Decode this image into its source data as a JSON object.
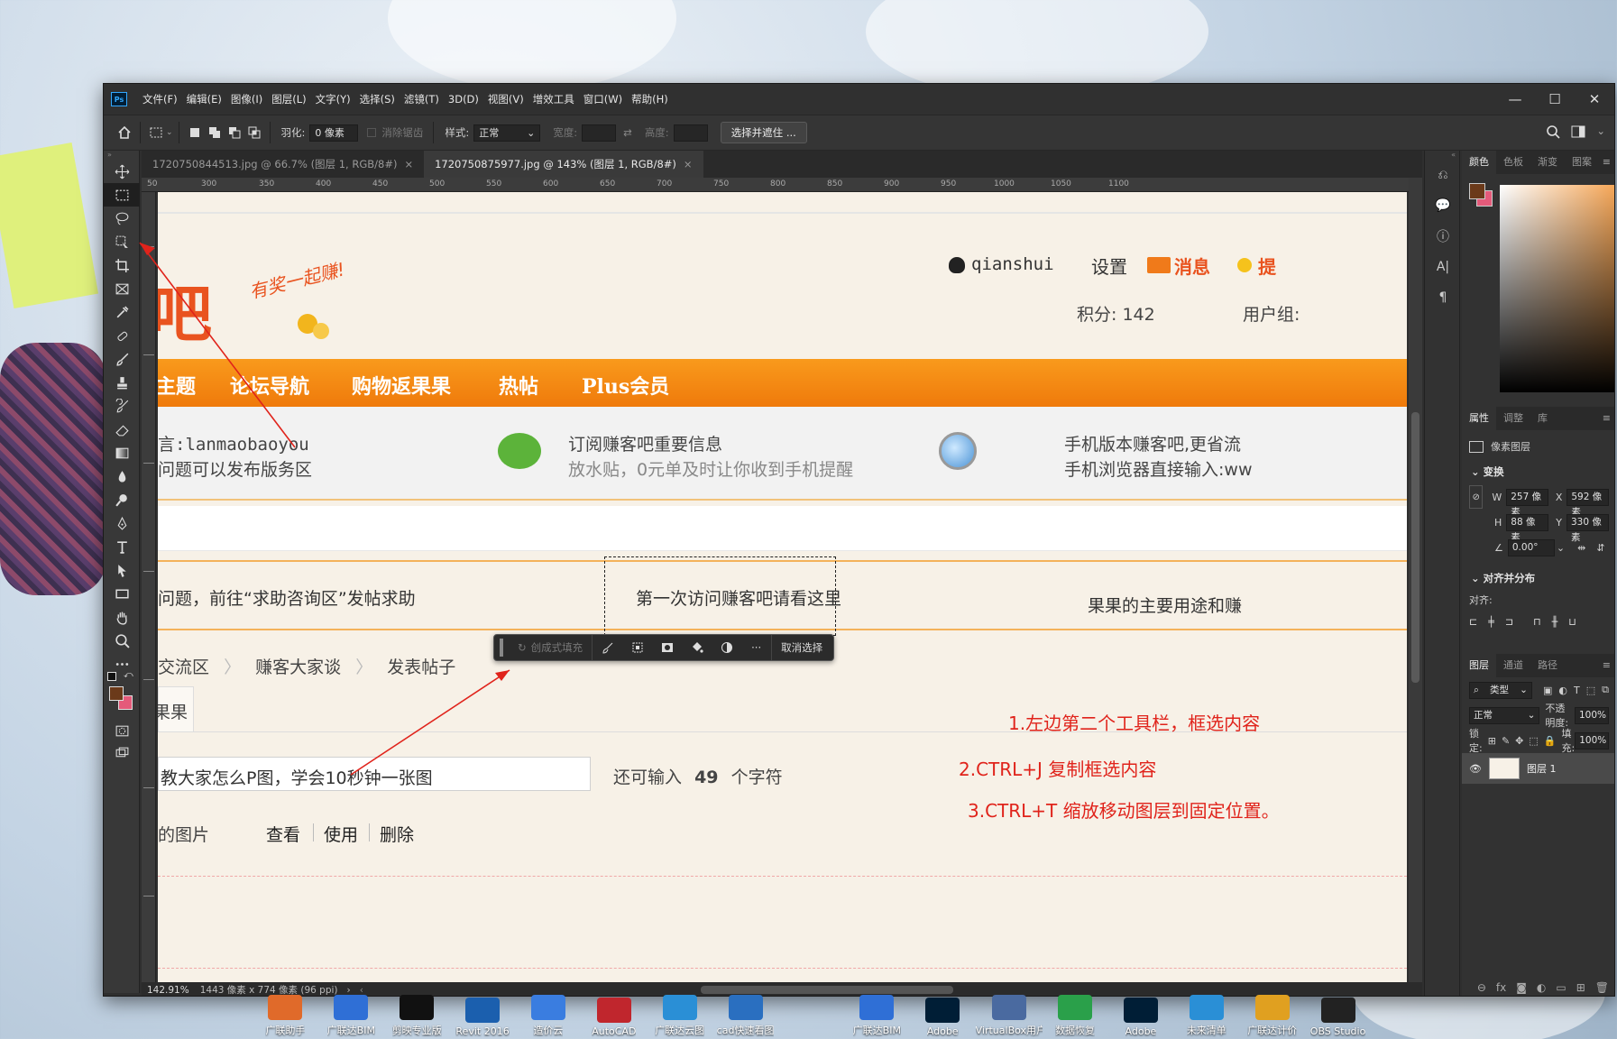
{
  "app": {
    "logo": "Ps"
  },
  "menu": [
    "文件(F)",
    "编辑(E)",
    "图像(I)",
    "图层(L)",
    "文字(Y)",
    "选择(S)",
    "滤镜(T)",
    "3D(D)",
    "视图(V)",
    "增效工具",
    "窗口(W)",
    "帮助(H)"
  ],
  "window_controls": {
    "minimize": "—",
    "maximize": "☐",
    "close": "✕"
  },
  "options": {
    "feather_label": "羽化:",
    "feather_value": "0 像素",
    "antialias_label": "消除锯齿",
    "style_label": "样式:",
    "style_value": "正常",
    "width_label": "宽度:",
    "height_label": "高度:",
    "select_mask": "选择并遮住 ..."
  },
  "tabs": [
    {
      "label": "1720750844513.jpg @ 66.7% (图层 1, RGB/8#)",
      "close": "×"
    },
    {
      "label": "1720750875977.jpg @ 143% (图层 1, RGB/8#)",
      "close": "×"
    }
  ],
  "ruler_labels": [
    "50",
    "300",
    "350",
    "400",
    "450",
    "500",
    "550",
    "600",
    "650",
    "700",
    "750",
    "800",
    "850",
    "900",
    "950",
    "1000",
    "1050",
    "1100"
  ],
  "status": {
    "zoom": "142.91%",
    "dims": "1443 像素 x 774 像素 (96 ppi)"
  },
  "canvas": {
    "logo_char": "吧",
    "slogan": "有奖一起赚!",
    "user": "qianshui",
    "settings": "设置",
    "messages": "消息",
    "remind": "提",
    "points": "积分: 142",
    "usergroup": "用户组:",
    "nav": [
      "主题",
      "论坛导航",
      "购物返果果",
      "热帖",
      "Plus会员"
    ],
    "info1_l1": "言:lanmaobaoyou",
    "info1_l2": "问题可以发布版务区",
    "info2_l1": "订阅赚客吧重要信息",
    "info2_l2": "放水贴，0元单及时让你收到手机提醒",
    "info3_l1": "手机版本赚客吧,更省流",
    "info3_l2": "手机浏览器直接输入:ww",
    "notice_left": "问题，前往“求助咨询区”发帖求助",
    "notice_mid": "第一次访问赚客吧请看这里",
    "notice_right": "果果的主要用途和赚",
    "crumb": [
      "交流区",
      "赚客大家谈",
      "发表帖子"
    ],
    "tab_guo": "果果",
    "title_input": "教大家怎么P图，学会10秒钟一张图",
    "char_left_pre": "还可输入",
    "char_left_num": "49",
    "char_left_post": "个字符",
    "img_label": "的图片",
    "img_actions": [
      "查看",
      "使用",
      "删除"
    ]
  },
  "ctx_bar": {
    "gen_fill": "创成式填充",
    "deselect": "取消选择"
  },
  "annotations": [
    "1.左边第二个工具栏，框选内容",
    "2.CTRL+J  复制框选内容",
    "3.CTRL+T  缩放移动图层到固定位置。"
  ],
  "panels": {
    "color_tabs": [
      "颜色",
      "色板",
      "渐变",
      "图案"
    ],
    "prop_tabs": [
      "属性",
      "调整",
      "库"
    ],
    "pixel_layer": "像素图层",
    "transform_title": "变换",
    "w_label": "W",
    "w_value": "257 像素",
    "x_label": "X",
    "x_value": "592 像素",
    "h_label": "H",
    "h_value": "88 像素",
    "y_label": "Y",
    "y_value": "330 像素",
    "angle_value": "0.00°",
    "align_title": "对齐并分布",
    "align_label": "对齐:",
    "layer_tabs": [
      "图层",
      "通道",
      "路径"
    ],
    "kind": "类型",
    "blend_mode": "正常",
    "opacity_label": "不透明度:",
    "opacity_value": "100%",
    "lock_label": "锁定:",
    "fill_label": "填充:",
    "fill_value": "100%",
    "layer_name": "图层 1"
  },
  "taskbar": [
    {
      "label": "广联助手",
      "color": "#e06a2a"
    },
    {
      "label": "广联达BIM",
      "color": "#2f6fd6"
    },
    {
      "label": "剪映专业版",
      "color": "#111111"
    },
    {
      "label": "Revit 2016",
      "color": "#1b5fae"
    },
    {
      "label": "造价云",
      "color": "#3a7de0"
    },
    {
      "label": "AutoCAD",
      "color": "#c0262d"
    },
    {
      "label": "广联达云图",
      "color": "#2a8fd6"
    },
    {
      "label": "cad快速看图",
      "color": "#2a6fc0"
    },
    {
      "label": "",
      "color": "transparent"
    },
    {
      "label": "广联达BIM",
      "color": "#2f6fd6"
    },
    {
      "label": "Adobe",
      "color": "#001e36"
    },
    {
      "label": "VirtualBox用户",
      "color": "#4a6aa0"
    },
    {
      "label": "数据恢复",
      "color": "#2aa04a"
    },
    {
      "label": "Adobe",
      "color": "#001e36"
    },
    {
      "label": "未来清单",
      "color": "#2a8fd6"
    },
    {
      "label": "广联达计价",
      "color": "#e0a020"
    },
    {
      "label": "OBS Studio",
      "color": "#222222"
    }
  ],
  "colors": {
    "accent_orange": "#f18a12",
    "fg_swatch": "#6b3a1a",
    "bg_swatch": "#e45a7a",
    "annotation_red": "#e0231b"
  }
}
